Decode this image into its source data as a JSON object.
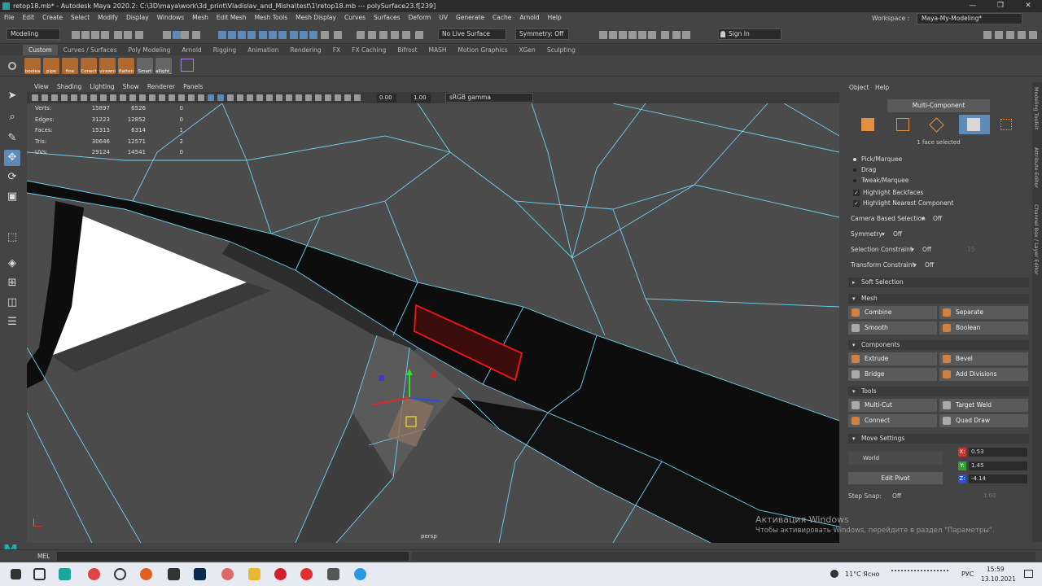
{
  "window": {
    "title": "retop18.mb* - Autodesk Maya 2020.2: C:\\3D\\maya\\work\\3d_print\\Vladislav_and_Misha\\test\\1\\retop18.mb  ---  polySurface23.f[239]",
    "min": "—",
    "max": "❐",
    "close": "✕"
  },
  "menu": [
    "File",
    "Edit",
    "Create",
    "Select",
    "Modify",
    "Display",
    "Windows",
    "Mesh",
    "Edit Mesh",
    "Mesh Tools",
    "Mesh Display",
    "Curves",
    "Surfaces",
    "Deform",
    "UV",
    "Generate",
    "Cache",
    "Arnold",
    "Help"
  ],
  "workspace": {
    "label": "Workspace :",
    "value": "Maya-My-Modeling*"
  },
  "status": {
    "mode": "Modeling",
    "live_surface": "No Live Surface",
    "symmetry": "Symmetry: Off",
    "sign_in": "Sign In"
  },
  "shelf_tabs": [
    "Custom",
    "Curves / Surfaces",
    "Poly Modeling",
    "Arnold",
    "Rigging",
    "Animation",
    "Rendering",
    "FX",
    "FX Caching",
    "Bifrost",
    "MASH",
    "Motion Graphics",
    "XGen",
    "Sculpting"
  ],
  "shelf_buttons": [
    "boolea",
    "pipe",
    "fine",
    "Conect",
    "virawni",
    "flatten",
    "Smart",
    "allight_v"
  ],
  "viewport_menu": [
    "View",
    "Shading",
    "Lighting",
    "Show",
    "Renderer",
    "Panels"
  ],
  "viewport_bar": {
    "exposure": "0.00",
    "gamma": "1.00",
    "color_space": "sRGB gamma"
  },
  "hud": [
    {
      "label": "Verts:",
      "a": "15897",
      "b": "6526",
      "c": "0"
    },
    {
      "label": "Edges:",
      "a": "31223",
      "b": "12852",
      "c": "0"
    },
    {
      "label": "Faces:",
      "a": "15313",
      "b": "6314",
      "c": "1"
    },
    {
      "label": "Tris:",
      "a": "30646",
      "b": "12571",
      "c": "2"
    },
    {
      "label": "UVs:",
      "a": "29124",
      "b": "14541",
      "c": "0"
    }
  ],
  "camera_label": "persp",
  "panel": {
    "menu": [
      "Object",
      "Help"
    ],
    "mode": "Multi-Component",
    "selection_info": "1 face selected",
    "radios": [
      "Pick/Marquee",
      "Drag",
      "Tweak/Marquee"
    ],
    "checks": [
      "Highlight Backfaces",
      "Highlight Nearest Component"
    ],
    "settings": [
      {
        "label": "Camera Based Selection",
        "value": "Off"
      },
      {
        "label": "Symmetry",
        "value": "Off"
      },
      {
        "label": "Selection Constraint",
        "value": "Off",
        "extra": "15"
      },
      {
        "label": "Transform Constraint",
        "value": "Off"
      }
    ],
    "soft_selection": "Soft Selection",
    "mesh_section": "Mesh",
    "mesh_buttons": [
      "Combine",
      "Separate",
      "Smooth",
      "Boolean"
    ],
    "components_section": "Components",
    "components_buttons": [
      "Extrude",
      "Bevel",
      "Bridge",
      "Add Divisions"
    ],
    "tools_section": "Tools",
    "tools_buttons": [
      "Multi-Cut",
      "Target Weld",
      "Connect",
      "Quad Draw"
    ],
    "move_section": "Move Settings",
    "space": "World",
    "edit_pivot": "Edit Pivot",
    "x": "0.53",
    "y": "1.45",
    "z": "-4.14",
    "step_snap": "Step Snap:",
    "step_snap_value": "Off",
    "step_value": "1.00"
  },
  "side_tabs": [
    "Modeling Toolkit",
    "Attribute Editor",
    "Channel Box / Layer Editor"
  ],
  "cmd": {
    "label": "MEL"
  },
  "watermark": {
    "line1": "Активация Windows",
    "line2": "Чтобы активировать Windows, перейдите в раздел \"Параметры\"."
  },
  "taskbar": {
    "weather": "11°C  Ясно",
    "lang": "РУС",
    "time": "15:59",
    "date": "13.10.2021"
  },
  "colors": {
    "accent": "#5d8ab8",
    "wire": "#6fd2f0",
    "selected": "#e01818"
  }
}
